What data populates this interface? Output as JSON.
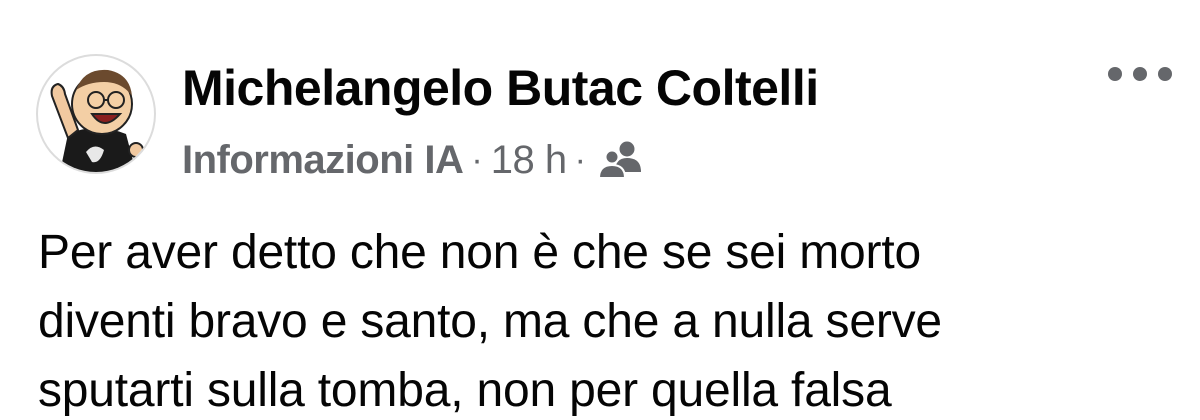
{
  "post": {
    "author": "Michelangelo Butac Coltelli",
    "group": "Informazioni IA",
    "separator": "·",
    "time": "18 h",
    "audience_icon": "friends-icon",
    "more_icon": "more-options-icon",
    "avatar_icon": "cartoon-avatar",
    "text_lines": [
      "Per aver detto che non è che se sei morto",
      "diventi bravo e santo, ma che a nulla serve",
      "sputarti sulla tomba, non per quella falsa"
    ]
  },
  "colors": {
    "text": "#050505",
    "secondary": "#65676b",
    "background": "#ffffff"
  }
}
